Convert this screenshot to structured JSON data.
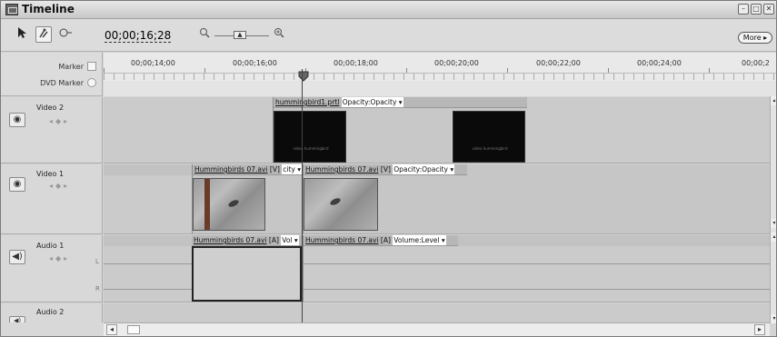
{
  "window": {
    "title": "Timeline",
    "btn_minimize": "–",
    "btn_maximize": "□",
    "btn_close": "✕"
  },
  "toolbar": {
    "timecode": "00;00;16;28",
    "more_label": "More ▸",
    "icons": [
      "selection-arrow-icon",
      "snap-icon",
      "marker-icon",
      "zoom-out-icon",
      "zoom-slider-icon",
      "zoom-in-icon"
    ]
  },
  "ruler": {
    "marker_label": "Marker",
    "dvd_marker_label": "DVD Marker",
    "times": [
      "00;00;14;00",
      "00;00;16;00",
      "00;00;18;00",
      "00;00;20;00",
      "00;00;22;00",
      "00;00;24;00",
      "00;00;2"
    ]
  },
  "tracks": {
    "video2": {
      "name": "Video 2"
    },
    "video1": {
      "name": "Video 1"
    },
    "audio1": {
      "name": "Audio 1",
      "left": "L",
      "right": "R"
    },
    "audio2": {
      "name": "Audio 2"
    }
  },
  "clips": {
    "v2_title": {
      "name": "hummingbird1.prtl",
      "effect": "Opacity:Opacity ▾",
      "preview_text": "video hummingbird"
    },
    "v1_a": {
      "name": "Hummingbirds 07.avi",
      "tag": "[V]",
      "effect": "city ▾"
    },
    "v1_b": {
      "name": "Hummingbirds 07.avi",
      "tag": "[V]",
      "effect": "Opacity:Opacity ▾"
    },
    "a1_a": {
      "name": "Hummingbirds 07.avi",
      "tag": "[A]",
      "effect": "Vol ▾"
    },
    "a1_b": {
      "name": "Hummingbirds 07.avi",
      "tag": "[A]",
      "effect": "Volume:Level ▾"
    }
  },
  "scrollbar": {
    "left_arrow": "◂",
    "right_arrow": "▸",
    "up_arrow": "▴",
    "down_arrow": "▾"
  }
}
